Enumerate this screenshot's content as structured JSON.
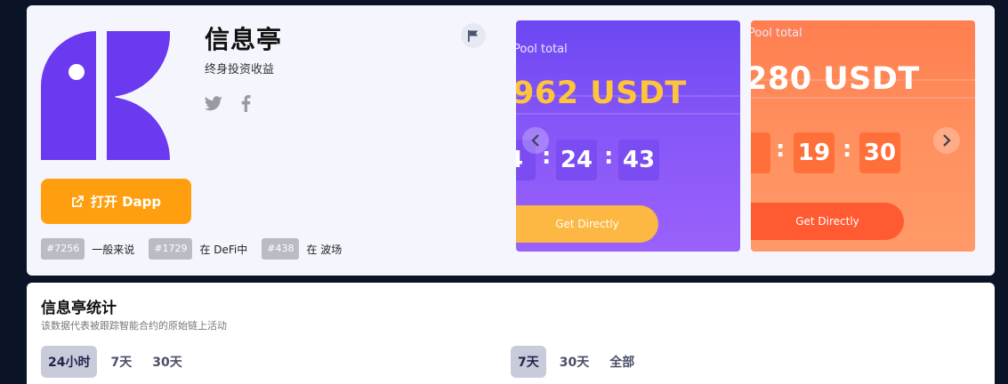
{
  "app": {
    "title": "信息亭",
    "subtitle": "终身投资收益",
    "social": {
      "twitter_icon": "twitter-icon",
      "facebook_icon": "facebook-icon"
    },
    "flag_icon": "flag-icon",
    "open_button": {
      "label": "打开 Dapp",
      "icon": "external-link-icon",
      "color": "#ff9f0f"
    },
    "tags": [
      {
        "rank": "#7256",
        "label": "一般来说"
      },
      {
        "rank": "#1729",
        "label": "在 DeFi中"
      },
      {
        "rank": "#438",
        "label": "在 波场"
      }
    ]
  },
  "banners": [
    {
      "pool_label": "Pool total",
      "amount": "962 USDT",
      "time": {
        "partial": "4",
        "mm": "24",
        "ss": "43"
      },
      "button": "Get Directly",
      "colors": {
        "bg": "#7b4ff5",
        "amount": "#ffc53a",
        "button": "#fdb743"
      }
    },
    {
      "pool_label": "Pool total",
      "amount": "280 USDT",
      "time": {
        "partial": "",
        "mm": "19",
        "ss": "30"
      },
      "button": "Get Directly",
      "colors": {
        "bg": "#ff8a5a",
        "amount": "#ffffff",
        "button": "#ff5a32"
      }
    }
  ],
  "carousel": {
    "prev_icon": "chevron-left-icon",
    "next_icon": "chevron-right-icon"
  },
  "stats": {
    "title": "信息亭统计",
    "subtitle": "该数据代表被跟踪智能合约的原始链上活动",
    "left_tabs": [
      {
        "label": "24小时",
        "active": true
      },
      {
        "label": "7天",
        "active": false
      },
      {
        "label": "30天",
        "active": false
      }
    ],
    "right_tabs": [
      {
        "label": "7天",
        "active": true
      },
      {
        "label": "30天",
        "active": false
      },
      {
        "label": "全部",
        "active": false
      }
    ]
  }
}
